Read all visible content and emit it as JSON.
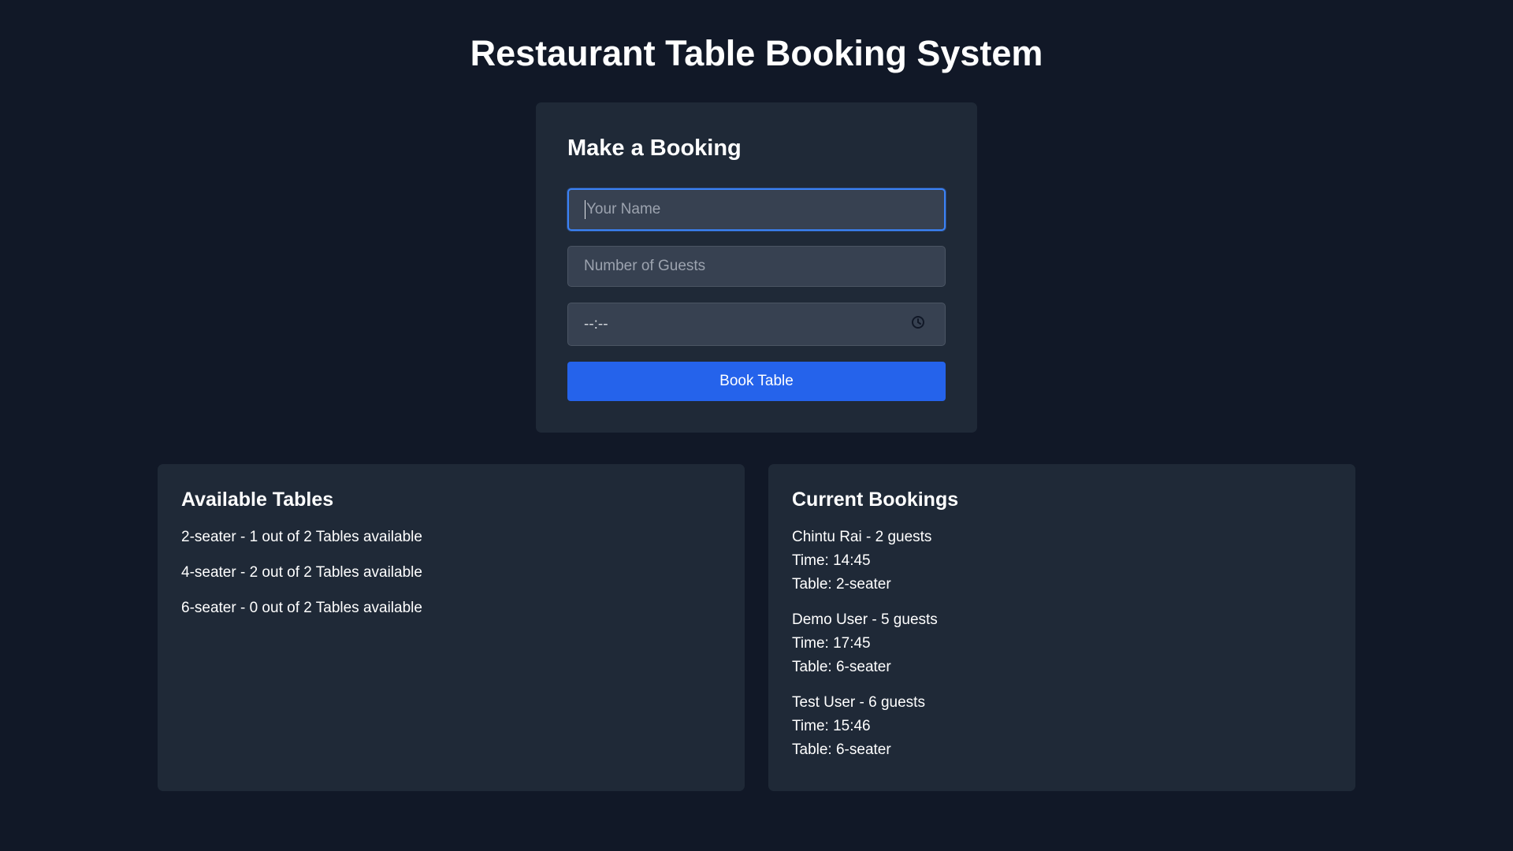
{
  "header": {
    "title": "Restaurant Table Booking System"
  },
  "booking_form": {
    "heading": "Make a Booking",
    "name_placeholder": "Your Name",
    "guests_placeholder": "Number of Guests",
    "time_value": "--:--",
    "time_icon": "clock-icon",
    "submit_label": "Book Table"
  },
  "available_tables": {
    "heading": "Available Tables",
    "items": [
      "2-seater - 1 out of 2 Tables available",
      "4-seater - 2 out of 2 Tables available",
      "6-seater - 0 out of 2 Tables available"
    ]
  },
  "current_bookings": {
    "heading": "Current Bookings",
    "items": [
      {
        "summary": "Chintu Rai - 2 guests",
        "time": "Time: 14:45",
        "table": "Table: 2-seater"
      },
      {
        "summary": "Demo User - 5 guests",
        "time": "Time: 17:45",
        "table": "Table: 6-seater"
      },
      {
        "summary": "Test User - 6 guests",
        "time": "Time: 15:46",
        "table": "Table: 6-seater"
      }
    ]
  },
  "colors": {
    "background": "#111827",
    "card": "#1f2937",
    "input": "#374151",
    "accent": "#2563eb",
    "focus_ring": "#3b82f6"
  }
}
